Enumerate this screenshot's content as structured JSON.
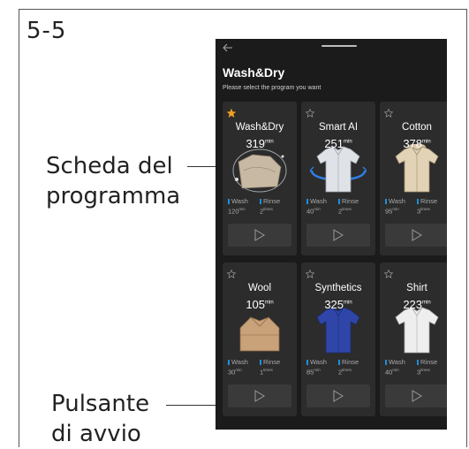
{
  "figure": {
    "page_number": "5-5",
    "callouts": [
      {
        "lines": [
          "Scheda del",
          "programma"
        ]
      },
      {
        "lines": [
          "Pulsante",
          "di avvio"
        ]
      }
    ]
  },
  "screen": {
    "back_icon": "arrow-left-icon",
    "title": "Wash&Dry",
    "subtitle": "Please select the program you want",
    "wash_label": "Wash",
    "rinse_label": "Rinse",
    "min_unit": "min",
    "times_unit": "times",
    "programs": [
      {
        "name": "Wash&Dry",
        "time": "319",
        "wash": "120",
        "rinse": "2",
        "favorite": true,
        "image": "wash-dry-garment"
      },
      {
        "name": "Smart AI",
        "time": "251",
        "wash": "40",
        "rinse": "2",
        "favorite": false,
        "image": "smart-ai-shirt"
      },
      {
        "name": "Cotton",
        "time": "378",
        "wash": "95",
        "rinse": "3",
        "favorite": false,
        "image": "cotton-hoodie"
      },
      {
        "name": "Wool",
        "time": "105",
        "wash": "30",
        "rinse": "1",
        "favorite": false,
        "image": "wool-sweater"
      },
      {
        "name": "Synthetics",
        "time": "325",
        "wash": "85",
        "rinse": "2",
        "favorite": false,
        "image": "synthetics-shirt"
      },
      {
        "name": "Shirt",
        "time": "223",
        "wash": "40",
        "rinse": "3",
        "favorite": false,
        "image": "white-shirt"
      }
    ]
  }
}
